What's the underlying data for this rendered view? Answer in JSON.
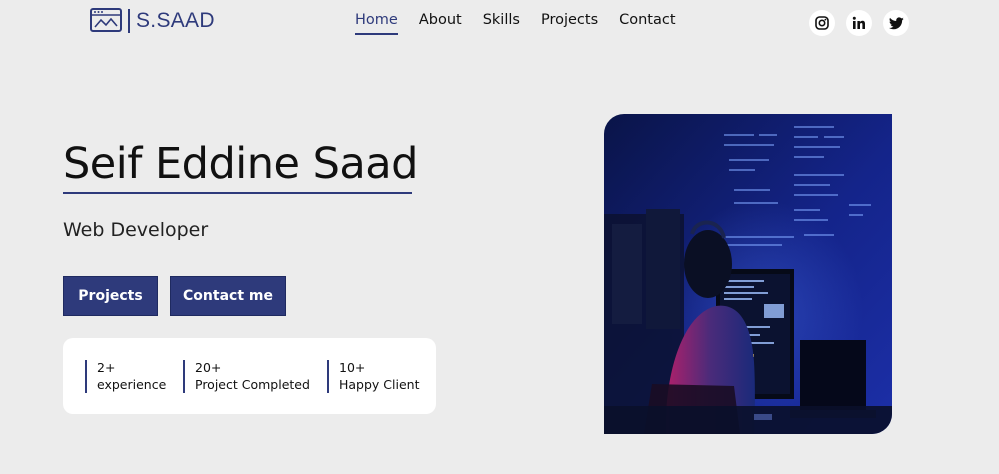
{
  "brand": {
    "logo_text": "S.SAAD"
  },
  "nav": {
    "items": [
      {
        "label": "Home",
        "active": true
      },
      {
        "label": "About",
        "active": false
      },
      {
        "label": "Skills",
        "active": false
      },
      {
        "label": "Projects",
        "active": false
      },
      {
        "label": "Contact",
        "active": false
      }
    ]
  },
  "social": [
    {
      "icon": "instagram-icon"
    },
    {
      "icon": "linkedin-icon"
    },
    {
      "icon": "twitter-icon"
    }
  ],
  "hero": {
    "name": "Seif Eddine Saad",
    "role": "Web Developer",
    "buttons": {
      "projects": "Projects",
      "contact": "Contact me"
    },
    "stats": [
      {
        "value": "2+",
        "label": "experience"
      },
      {
        "value": "20+",
        "label": "Project Completed"
      },
      {
        "value": "10+",
        "label": "Happy Client"
      }
    ]
  },
  "colors": {
    "accent": "#2e3a7b",
    "background": "#ececec",
    "card": "#ffffff"
  }
}
